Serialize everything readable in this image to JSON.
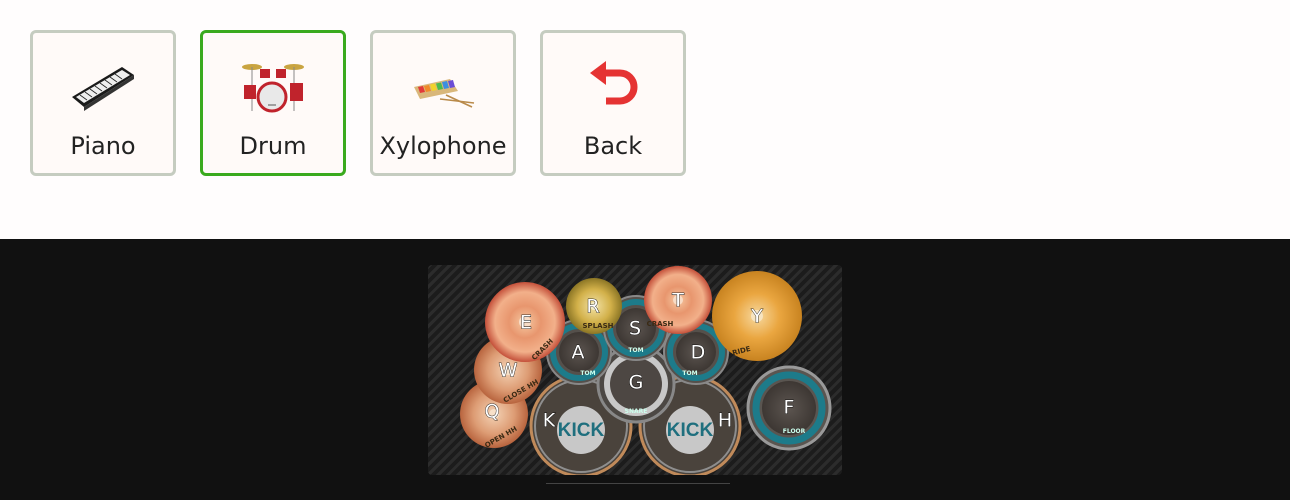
{
  "instruments": [
    {
      "label": "Piano",
      "icon": "piano-icon",
      "active": false
    },
    {
      "label": "Drum",
      "icon": "drum-kit-icon",
      "active": true
    },
    {
      "label": "Xylophone",
      "icon": "xylophone-icon",
      "active": false
    },
    {
      "label": "Back",
      "icon": "back-arrow-icon",
      "active": false
    }
  ],
  "kit": {
    "pads": {
      "E": {
        "key": "E",
        "label": "CRASH"
      },
      "R": {
        "key": "R",
        "label": "SPLASH"
      },
      "T": {
        "key": "T",
        "label": "CRASH"
      },
      "Y": {
        "key": "Y",
        "label": "RIDE"
      },
      "S": {
        "key": "S",
        "label": "TOM"
      },
      "A": {
        "key": "A",
        "label": "TOM"
      },
      "D": {
        "key": "D",
        "label": "TOM"
      },
      "G": {
        "key": "G",
        "label": "SNARE"
      },
      "W": {
        "key": "W",
        "label": "CLOSE HH"
      },
      "Q": {
        "key": "Q",
        "label": "OPEN HH"
      },
      "K": {
        "key": "K",
        "label": "KICK"
      },
      "H": {
        "key": "H",
        "label": "KICK"
      },
      "F": {
        "key": "F",
        "label": "FLOOR"
      }
    }
  },
  "colors": {
    "active_border": "#3aaa1e",
    "inactive_border": "#c5ccc0",
    "stage_bg": "#111111"
  }
}
